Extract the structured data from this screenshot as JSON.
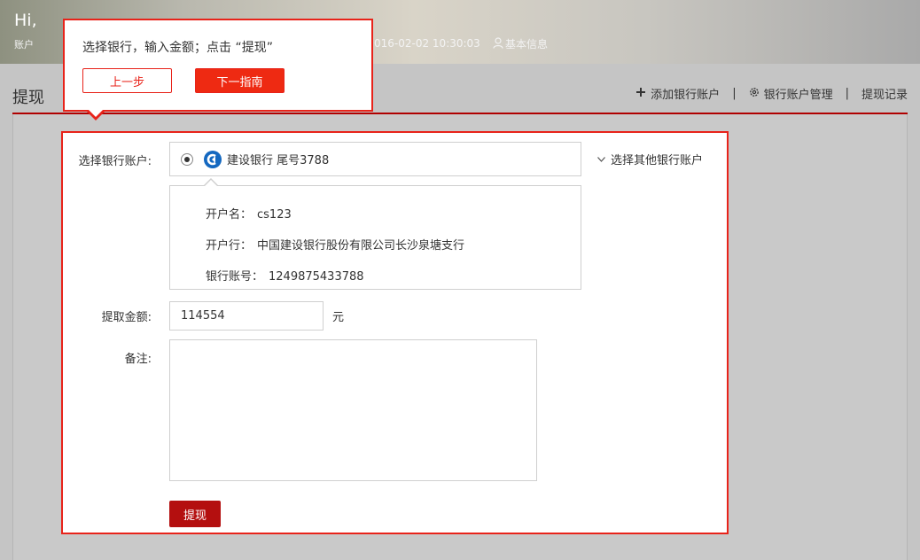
{
  "header": {
    "greeting": "Hi,",
    "account_label": "账户",
    "time": "016-02-02 10:30:03",
    "basic_info_label": "基本信息"
  },
  "title_bar": {
    "title": "提现",
    "add_bank": "添加银行账户",
    "manage_bank": "银行账户管理",
    "records": "提现记录",
    "separator": "|"
  },
  "form": {
    "bank_label": "选择银行账户:",
    "selected_bank": "建设银行 尾号3788",
    "other_bank": "选择其他银行账户",
    "detail": {
      "holder_key": "开户名：",
      "holder_value": "cs123",
      "branch_key": "开户行：",
      "branch_value": "中国建设银行股份有限公司长沙泉塘支行",
      "account_key": "银行账号：",
      "account_value": "1249875433788"
    },
    "amount_label": "提取金额:",
    "amount_value": "114554",
    "unit": "元",
    "remark_label": "备注:",
    "remark_value": "",
    "submit": "提现"
  },
  "guide": {
    "message": "选择银行，输入金额；点击 “提现”",
    "prev": "上一步",
    "next": "下一指南"
  },
  "colors": {
    "accent_red": "#e8231a",
    "submit_red": "#b40f0f",
    "bank_blue": "#1468c0"
  }
}
